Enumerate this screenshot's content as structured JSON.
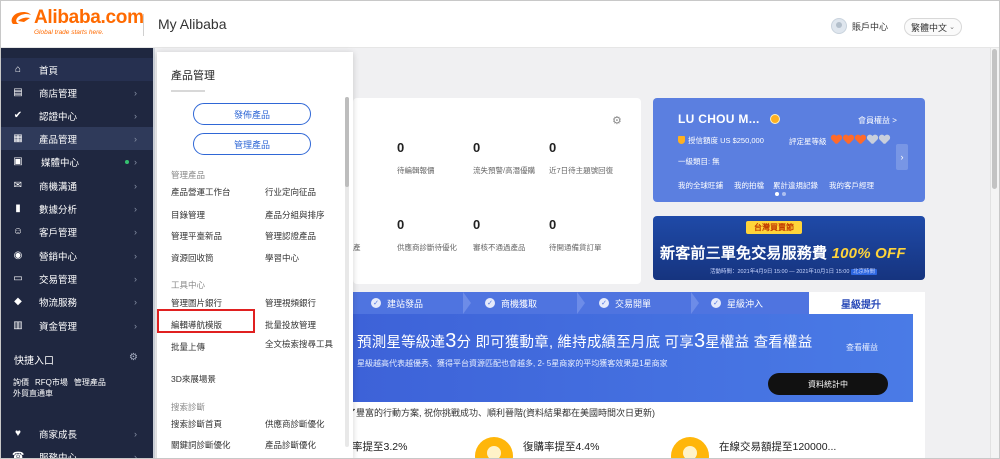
{
  "header": {
    "logo_word": "Alibaba.com",
    "logo_tagline": "Global trade starts here.",
    "title": "My Alibaba",
    "account_label": "賬戶中心",
    "language": "繁體中文"
  },
  "sidebar": {
    "items": [
      {
        "icon": "⌂",
        "icon_name": "home-icon",
        "label": "首頁"
      },
      {
        "icon": "▤",
        "icon_name": "store-icon",
        "label": "商店管理"
      },
      {
        "icon": "✔",
        "icon_name": "verification-icon",
        "label": "認證中心"
      },
      {
        "icon": "▦",
        "icon_name": "products-icon",
        "label": "產品管理"
      },
      {
        "icon": "▣",
        "icon_name": "media-icon",
        "label": "媒體中心"
      },
      {
        "icon": "✉",
        "icon_name": "messages-icon",
        "label": "商機溝通"
      },
      {
        "icon": "▮",
        "icon_name": "analytics-icon",
        "label": "數據分析"
      },
      {
        "icon": "☺",
        "icon_name": "customers-icon",
        "label": "客戶管理"
      },
      {
        "icon": "◉",
        "icon_name": "marketing-icon",
        "label": "營銷中心"
      },
      {
        "icon": "▭",
        "icon_name": "orders-icon",
        "label": "交易管理"
      },
      {
        "icon": "◆",
        "icon_name": "logistics-icon",
        "label": "物流服務"
      },
      {
        "icon": "▥",
        "icon_name": "funds-icon",
        "label": "資金管理"
      }
    ],
    "quick_title": "快捷入口",
    "quick_links": [
      "詢價",
      "RFQ市場",
      "管理產品",
      "外貿直通車"
    ],
    "bottom_items": [
      {
        "icon": "♥",
        "icon_name": "growth-icon",
        "label": "商家成長"
      },
      {
        "icon": "☎",
        "icon_name": "service-icon",
        "label": "服務中心"
      }
    ]
  },
  "flyout": {
    "title": "產品管理",
    "primary_button": "發佈產品",
    "secondary_button": "管理產品",
    "sections": [
      {
        "title": "管理產品",
        "links": [
          "產品營運工作台",
          "行业定向征品",
          "目錄管理",
          "產品分組與排序",
          "管理平臺新品",
          "管理認證產品",
          "資源回收筒",
          "學習中心"
        ]
      },
      {
        "title": "工具中心",
        "links": [
          "管理圖片銀行",
          "管理視頻銀行",
          "編輯導航模版",
          "批量投放管理",
          "批量上傳",
          "全文檢索搜尋工具",
          "3D來展場景"
        ]
      },
      {
        "title": "搜索診斷",
        "links": [
          "搜索診斷首頁",
          "供應商診斷優化",
          "關鍵詞診斷優化",
          "產品診斷優化"
        ]
      }
    ]
  },
  "stats": {
    "row1": [
      {
        "value": "0",
        "label": "待編輯報價"
      },
      {
        "value": "0",
        "label": "流失預警/高潛優購"
      },
      {
        "value": "0",
        "label": "近7日待主題號回復"
      }
    ],
    "row2": [
      {
        "value": "0",
        "label": "供應商診斷待優化"
      },
      {
        "value": "0",
        "label": "審核不通過產品"
      },
      {
        "value": "0",
        "label": "待開通備貨訂單"
      }
    ],
    "left_cut_label": "產"
  },
  "member_card": {
    "name": "LU CHOU M...",
    "link": "會員權益 >",
    "credit": "授信額度 US $250,000",
    "star_label": "評定星等級",
    "hearts_on": 3,
    "hearts_total": 5,
    "category": "一級類目: 無",
    "links": [
      "我的全球旺鋪",
      "我的拍檔",
      "累計違規記錄",
      "我的客戶經理"
    ],
    "colors": {
      "bg": "#5b7fe0",
      "accent": "#ffb020"
    }
  },
  "promo": {
    "top": "台灣買賣節",
    "main_prefix": "新客前三單免交易服務費",
    "main_highlight": "100% OFF",
    "sub": "活動時間：2021年4月9日 15:00 — 2021年10月1日 15:00",
    "sub_tag": "北京時間"
  },
  "steps": {
    "items": [
      "建站發品",
      "商機獲取",
      "交易開單",
      "星級沖入"
    ],
    "last": "星級提升"
  },
  "headline": {
    "title_a": "預測星等級達",
    "title_num1": "3",
    "title_b": "分 即可獲動章, 維持成績至月底 可享",
    "title_num2": "3",
    "title_c": "星權益 查看權益",
    "link": "查看權益",
    "sub": "星級越高代表越優秀、獲得平台資源匹配也會越多, 2- 5星商家的平均獲客效果是1星商家",
    "button": "資料統計中"
  },
  "plan_text": "了豐富的行動方案, 祝你挑戰成功、順利晉階(資料結果都在美國時間次日更新)",
  "kpis": [
    {
      "text": "轉化率提至3.2%"
    },
    {
      "text": "復購率提至4.4%"
    },
    {
      "text": "在線交易額提至120000..."
    }
  ]
}
